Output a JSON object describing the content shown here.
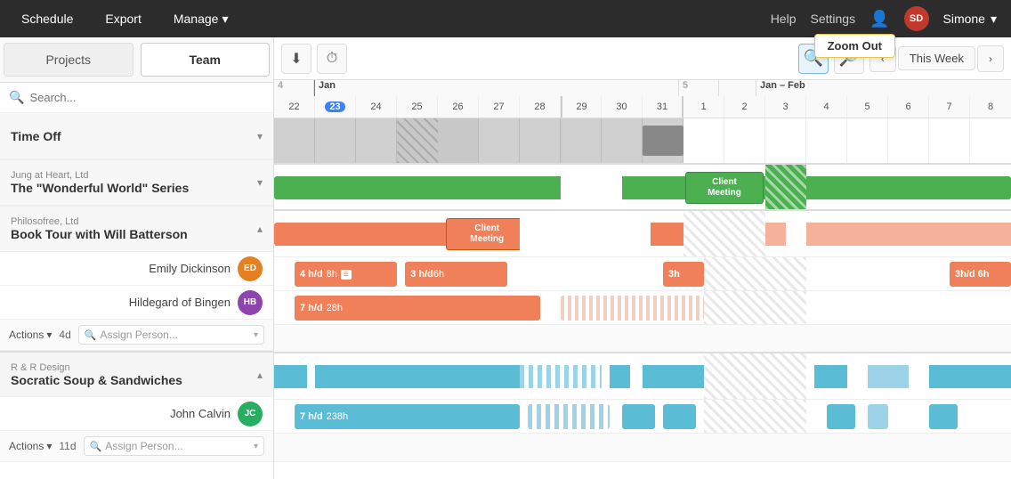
{
  "nav": {
    "items": [
      "Schedule",
      "Export",
      "Manage"
    ],
    "manage_arrow": "▾",
    "right": {
      "help": "Help",
      "settings": "Settings",
      "avatar_initials": "SD",
      "user": "Simone",
      "user_arrow": "▾"
    }
  },
  "sidebar": {
    "tabs": [
      "Projects",
      "Team"
    ],
    "active_tab": "Team",
    "search_placeholder": "Search...",
    "sections": [
      {
        "id": "time-off",
        "subtitle": "",
        "title": "Time Off",
        "expanded": false
      },
      {
        "id": "jung",
        "subtitle": "Jung at Heart, Ltd",
        "title": "The \"Wonderful World\" Series",
        "expanded": false
      },
      {
        "id": "philo",
        "subtitle": "Philosofree, Ltd",
        "title": "Book Tour with Will Batterson",
        "expanded": true,
        "people": [
          {
            "name": "Emily Dickinson",
            "avatar": "ED"
          },
          {
            "name": "Hildegard of Bingen",
            "avatar": "HB"
          }
        ],
        "actions": {
          "label": "Actions",
          "days": "4d",
          "assign_placeholder": "Assign Person..."
        }
      },
      {
        "id": "rnr",
        "subtitle": "R & R Design",
        "title": "Socratic Soup & Sandwiches",
        "expanded": true,
        "people": [
          {
            "name": "John Calvin",
            "avatar": "JC"
          }
        ],
        "actions": {
          "label": "Actions",
          "days": "11d",
          "assign_placeholder": "Assign Person..."
        }
      }
    ]
  },
  "calendar": {
    "toolbar": {
      "filter_icon": "≡",
      "clock_icon": "◷",
      "zoom_in_icon": "⊕",
      "zoom_out_icon": "⊖",
      "prev_icon": "‹",
      "next_icon": "›",
      "this_week": "This Week"
    },
    "zoom_tooltip": "Zoom Out",
    "months": [
      {
        "label": "4",
        "sub": "Jan",
        "days": [
          "22",
          "23",
          "24",
          "25",
          "26",
          "27",
          "28",
          "29",
          "30",
          "31"
        ]
      },
      {
        "label": "5",
        "sub": "Jan – Feb",
        "days": [
          "1",
          "2",
          "3",
          "4",
          "5",
          "6",
          "7",
          "8"
        ]
      }
    ],
    "today_day": "23"
  },
  "colors": {
    "green": "#4caf50",
    "orange": "#f0805a",
    "orange_light": "#f5b19a",
    "blue": "#5bbcd6",
    "blue_light": "#9dd3e8",
    "gray": "#aaaaaa",
    "today_bg": "#3b82f6",
    "tooltip_border": "#e8c84c"
  }
}
